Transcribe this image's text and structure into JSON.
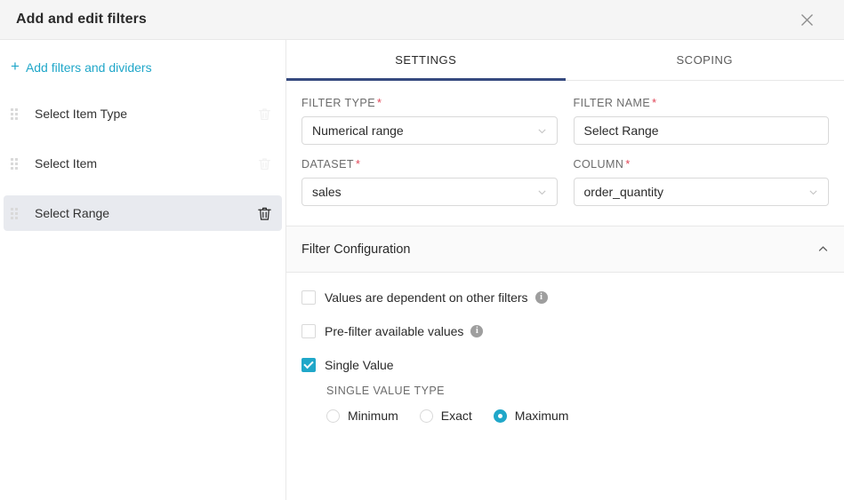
{
  "header": {
    "title": "Add and edit filters",
    "close_icon": "close-icon"
  },
  "sidebar": {
    "add_link": "Add filters and dividers",
    "add_icon": "plus-icon",
    "items": [
      {
        "label": "Select Item Type",
        "active": false
      },
      {
        "label": "Select Item",
        "active": false
      },
      {
        "label": "Select Range",
        "active": true
      }
    ]
  },
  "tabs": [
    {
      "label": "SETTINGS",
      "active": true
    },
    {
      "label": "SCOPING",
      "active": false
    }
  ],
  "form": {
    "filter_type": {
      "label": "FILTER TYPE",
      "required": "*",
      "value": "Numerical range"
    },
    "filter_name": {
      "label": "FILTER NAME",
      "required": "*",
      "value": "Select Range"
    },
    "dataset": {
      "label": "DATASET",
      "required": "*",
      "value": "sales"
    },
    "column": {
      "label": "COLUMN",
      "required": "*",
      "value": "order_quantity"
    }
  },
  "filter_configuration": {
    "title": "Filter Configuration",
    "collapse_icon": "chevron-up-icon",
    "options": [
      {
        "label": "Values are dependent on other filters",
        "checked": false,
        "info": "i"
      },
      {
        "label": "Pre-filter available values",
        "checked": false,
        "info": "i"
      },
      {
        "label": "Single Value",
        "checked": true
      }
    ],
    "single_value_type": {
      "label": "SINGLE VALUE TYPE",
      "options": [
        {
          "label": "Minimum",
          "selected": false
        },
        {
          "label": "Exact",
          "selected": false
        },
        {
          "label": "Maximum",
          "selected": true
        }
      ]
    }
  },
  "colors": {
    "accent": "#20a7c9",
    "tab_active": "#364a7f",
    "required": "#e04355",
    "header_bg": "#f5f5f5",
    "row_active_bg": "#e8eaef"
  }
}
